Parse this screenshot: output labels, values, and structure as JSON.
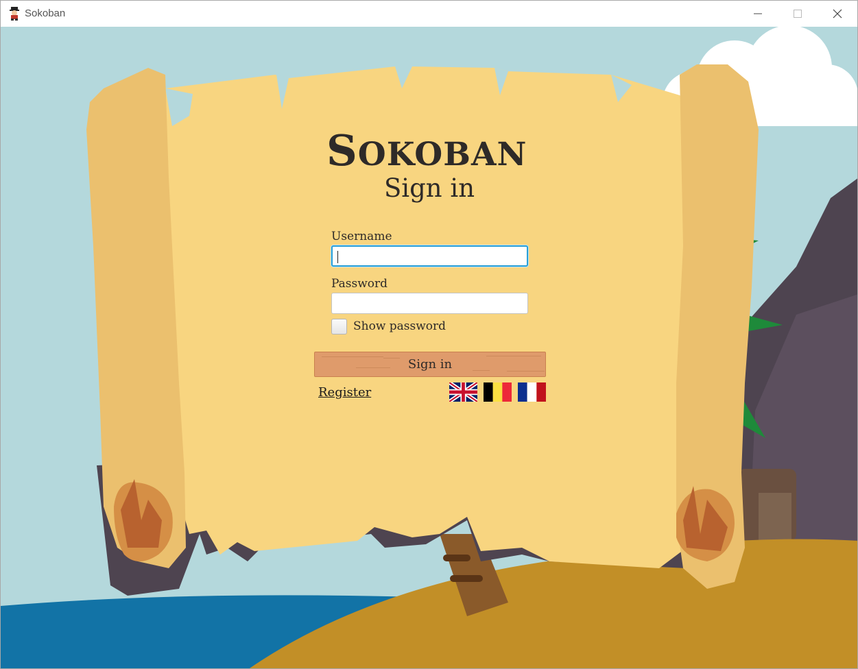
{
  "window": {
    "title": "Sokoban",
    "controls": [
      "minimize",
      "maximize",
      "close"
    ]
  },
  "login": {
    "logo_text_first": "S",
    "logo_text_rest": "OKOBAN",
    "heading": "Sign in",
    "username_label": "Username",
    "username_value": "",
    "password_label": "Password",
    "password_value": "",
    "show_password_label": "Show password",
    "show_password_checked": false,
    "sign_in_button": "Sign in",
    "register_link": "Register"
  },
  "languages": [
    {
      "icon": "uk-flag-icon"
    },
    {
      "icon": "belgium-flag-icon"
    },
    {
      "icon": "france-flag-icon"
    }
  ],
  "colors": {
    "sky": "#b4d8dc",
    "parchment": "#f8d580",
    "parchment_roll": "#ebc06e",
    "sea": "#1273a6",
    "sand": "#c28f27",
    "button": "#df9b6b",
    "text": "#2e2a28"
  }
}
